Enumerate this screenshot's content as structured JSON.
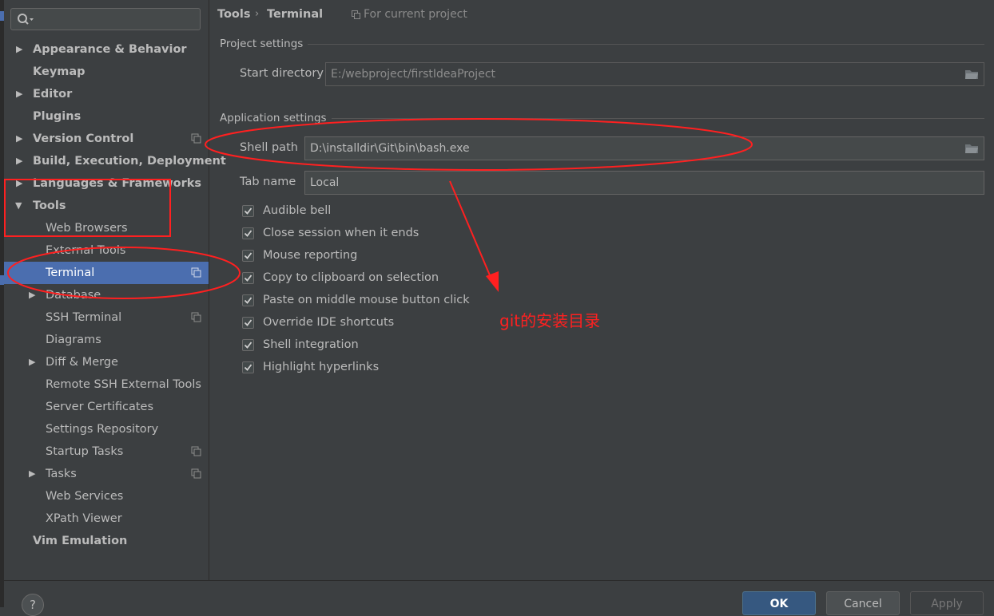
{
  "search": {
    "placeholder": ""
  },
  "sidebar": {
    "items": [
      {
        "label": "Appearance & Behavior",
        "arrow": "▶"
      },
      {
        "label": "Keymap",
        "arrow": ""
      },
      {
        "label": "Editor",
        "arrow": "▶"
      },
      {
        "label": "Plugins",
        "arrow": ""
      },
      {
        "label": "Version Control",
        "arrow": "▶"
      },
      {
        "label": "Build, Execution, Deployment",
        "arrow": "▶"
      },
      {
        "label": "Languages & Frameworks",
        "arrow": "▶"
      },
      {
        "label": "Tools",
        "arrow": "▼"
      },
      {
        "label": "Web Browsers",
        "arrow": ""
      },
      {
        "label": "External Tools",
        "arrow": ""
      },
      {
        "label": "Terminal",
        "arrow": ""
      },
      {
        "label": "Database",
        "arrow": "▶"
      },
      {
        "label": "SSH Terminal",
        "arrow": ""
      },
      {
        "label": "Diagrams",
        "arrow": ""
      },
      {
        "label": "Diff & Merge",
        "arrow": "▶"
      },
      {
        "label": "Remote SSH External Tools",
        "arrow": ""
      },
      {
        "label": "Server Certificates",
        "arrow": ""
      },
      {
        "label": "Settings Repository",
        "arrow": ""
      },
      {
        "label": "Startup Tasks",
        "arrow": ""
      },
      {
        "label": "Tasks",
        "arrow": "▶"
      },
      {
        "label": "Web Services",
        "arrow": ""
      },
      {
        "label": "XPath Viewer",
        "arrow": ""
      },
      {
        "label": "Vim Emulation",
        "arrow": ""
      }
    ]
  },
  "breadcrumb": {
    "parent": "Tools",
    "separator": "›",
    "current": "Terminal"
  },
  "project_hint": "For current project",
  "project_settings": {
    "title": "Project settings",
    "start_directory_label": "Start directory",
    "start_directory_value": "E:/webproject/firstIdeaProject"
  },
  "application_settings": {
    "title": "Application settings",
    "shell_path_label": "Shell path",
    "shell_path_value": "D:\\installdir\\Git\\bin\\bash.exe",
    "tab_name_label": "Tab name",
    "tab_name_value": "Local"
  },
  "options": [
    {
      "label": "Audible bell",
      "checked": true
    },
    {
      "label": "Close session when it ends",
      "checked": true
    },
    {
      "label": "Mouse reporting",
      "checked": true
    },
    {
      "label": "Copy to clipboard on selection",
      "checked": true
    },
    {
      "label": "Paste on middle mouse button click",
      "checked": true
    },
    {
      "label": "Override IDE shortcuts",
      "checked": true
    },
    {
      "label": "Shell integration",
      "checked": true
    },
    {
      "label": "Highlight hyperlinks",
      "checked": true
    }
  ],
  "footer": {
    "help": "?",
    "ok": "OK",
    "cancel": "Cancel",
    "apply": "Apply"
  },
  "annotation": {
    "text": "git的安装目录",
    "color": "#ff2020"
  },
  "colors": {
    "selected": "#4b6eaf",
    "background": "#3c3f41",
    "field": "#45494a"
  }
}
